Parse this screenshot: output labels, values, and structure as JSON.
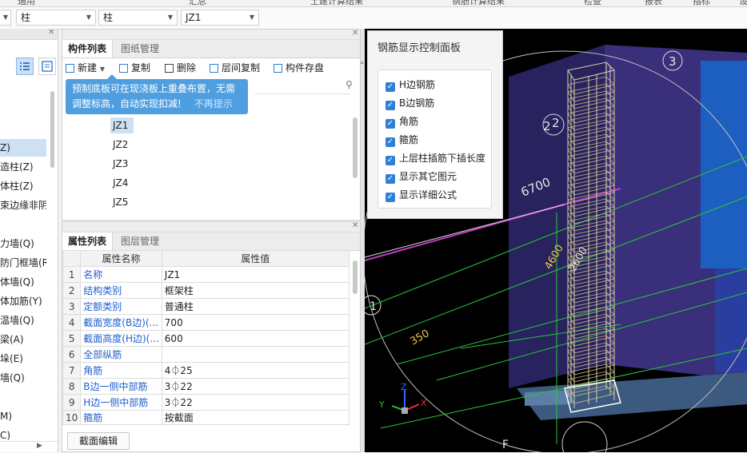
{
  "top_menu": [
    "通用",
    "汇总",
    "土建计算结果",
    "钢筋计算结果",
    "检查",
    "报表",
    "指标",
    "设"
  ],
  "toolbar": {
    "combos": [
      {
        "value": ""
      },
      {
        "value": "柱"
      },
      {
        "value": "柱"
      },
      {
        "value": "JZ1"
      }
    ]
  },
  "left_tree": {
    "items": [
      {
        "label": "Z)",
        "selected": true
      },
      {
        "label": "造柱(Z)"
      },
      {
        "label": "体柱(Z)"
      },
      {
        "label": "束边缘非阴影"
      },
      {
        "label": "力墙(Q)"
      },
      {
        "label": "防门框墙(RF"
      },
      {
        "label": "体墙(Q)"
      },
      {
        "label": "体加筋(Y)"
      },
      {
        "label": "温墙(Q)"
      },
      {
        "label": "梁(A)"
      },
      {
        "label": "垛(E)"
      },
      {
        "label": "墙(Q)"
      },
      {
        "label": "M)"
      },
      {
        "label": "C)"
      }
    ]
  },
  "component_panel": {
    "tabs": [
      "构件列表",
      "图纸管理"
    ],
    "actions": {
      "new": "新建",
      "copy": "复制",
      "delete": "删除",
      "floor_copy": "层间复制",
      "save": "构件存盘"
    },
    "tip": {
      "line1": "预制底板可在现浇板上重叠布置，无需",
      "line2": "调整标高，自动实现扣减!",
      "dismiss": "不再提示"
    },
    "items": [
      {
        "label": "JZ1",
        "selected": true
      },
      {
        "label": "JZ2"
      },
      {
        "label": "JZ3"
      },
      {
        "label": "JZ4"
      },
      {
        "label": "JZ5"
      }
    ]
  },
  "props_panel": {
    "tabs": [
      "属性列表",
      "图层管理"
    ],
    "headers": {
      "name": "属性名称",
      "value": "属性值"
    },
    "rows": [
      {
        "no": "1",
        "name": "名称",
        "value": "JZ1"
      },
      {
        "no": "2",
        "name": "结构类别",
        "value": "框架柱"
      },
      {
        "no": "3",
        "name": "定额类别",
        "value": "普通柱"
      },
      {
        "no": "4",
        "name": "截面宽度(B边)(...",
        "value": "700"
      },
      {
        "no": "5",
        "name": "截面高度(H边)(...",
        "value": "600"
      },
      {
        "no": "6",
        "name": "全部纵筋",
        "value": ""
      },
      {
        "no": "7",
        "name": "角筋",
        "value": "4⏀25"
      },
      {
        "no": "8",
        "name": "B边一侧中部筋",
        "value": "3⏀22"
      },
      {
        "no": "9",
        "name": "H边一侧中部筋",
        "value": "3⏀22"
      },
      {
        "no": "10",
        "name": "箍筋",
        "value": "按截面"
      }
    ],
    "edit_button": "截面编辑"
  },
  "rebar_panel": {
    "title": "钢筋显示控制面板",
    "options": [
      {
        "label": "H边钢筋",
        "checked": true
      },
      {
        "label": "B边钢筋",
        "checked": true
      },
      {
        "label": "角筋",
        "checked": true
      },
      {
        "label": "箍筋",
        "checked": true
      },
      {
        "label": "上层柱插筋下插长度",
        "checked": true
      },
      {
        "label": "显示其它图元",
        "checked": true
      },
      {
        "label": "显示详细公式",
        "checked": true
      }
    ]
  },
  "viewport": {
    "labels": {
      "axis3": "3",
      "axis2": "2",
      "axis2b": "2",
      "axis1": "1",
      "axisF": "F",
      "dim6700": "6700",
      "dim4600": "4600",
      "dim350": "350",
      "dim2600": "2600"
    },
    "axes": {
      "x": "X",
      "y": "Y",
      "z": "Z"
    }
  },
  "colors": {
    "accent": "#2f7fd6",
    "tip": "#4f9fe0",
    "link_text": "#1f5fcc"
  }
}
